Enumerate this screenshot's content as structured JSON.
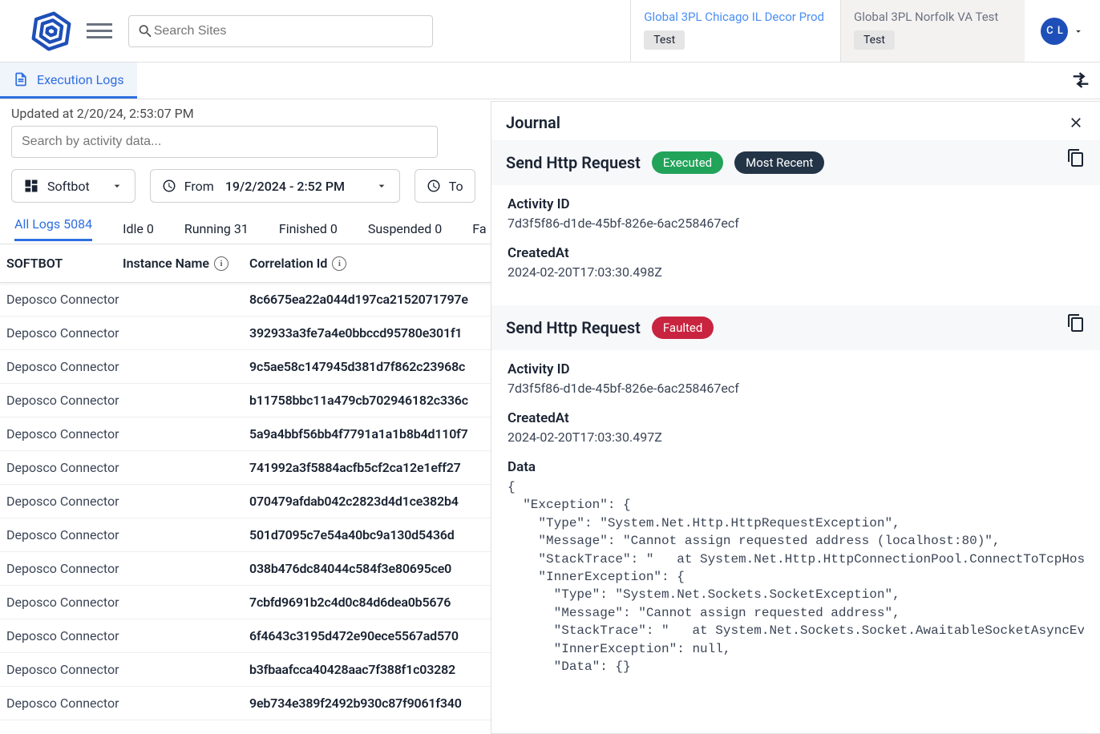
{
  "header": {
    "search_placeholder": "Search Sites",
    "tabs": [
      {
        "title": "Global 3PL Chicago IL Decor Prod",
        "chip": "Test",
        "active": true
      },
      {
        "title": "Global 3PL Norfolk VA Test",
        "chip": "Test",
        "active": false
      }
    ],
    "user_initials": "C L"
  },
  "module_tab": "Execution Logs",
  "updated_at": "Updated at 2/20/24, 2:53:07 PM",
  "activity_search_placeholder": "Search by activity data...",
  "filters": {
    "softbot_label": "Softbot",
    "from_label": "From",
    "from_value": "19/2/2024 - 2:52 PM",
    "to_label": "To"
  },
  "status_tabs": [
    {
      "label": "All Logs",
      "count": "5084",
      "active": true
    },
    {
      "label": "Idle",
      "count": "0"
    },
    {
      "label": "Running",
      "count": "31"
    },
    {
      "label": "Finished",
      "count": "0"
    },
    {
      "label": "Suspended",
      "count": "0"
    },
    {
      "label": "Fa",
      "count": ""
    }
  ],
  "columns": {
    "softbot": "SOFTBOT",
    "instance": "Instance Name",
    "correlation": "Correlation Id"
  },
  "rows": [
    {
      "softbot": "Deposco Connector",
      "corr": "8c6675ea22a044d197ca2152071797e"
    },
    {
      "softbot": "Deposco Connector",
      "corr": "392933a3fe7a4e0bbccd95780e301f1"
    },
    {
      "softbot": "Deposco Connector",
      "corr": "9c5ae58c147945d381d7f862c23968c"
    },
    {
      "softbot": "Deposco Connector",
      "corr": "b11758bbc11a479cb702946182c336c"
    },
    {
      "softbot": "Deposco Connector",
      "corr": "5a9a4bbf56bb4f7791a1a1b8b4d110f7"
    },
    {
      "softbot": "Deposco Connector",
      "corr": "741992a3f5884acfb5cf2ca12e1eff27"
    },
    {
      "softbot": "Deposco Connector",
      "corr": "070479afdab042c2823d4d1ce382b4"
    },
    {
      "softbot": "Deposco Connector",
      "corr": "501d7095c7e54a40bc9a130d5436d"
    },
    {
      "softbot": "Deposco Connector",
      "corr": "038b476dc84044c584f3e80695ce0"
    },
    {
      "softbot": "Deposco Connector",
      "corr": "7cbfd9691b2c4d0c84d6dea0b5676"
    },
    {
      "softbot": "Deposco Connector",
      "corr": "6f4643c3195d472e90ece5567ad570"
    },
    {
      "softbot": "Deposco Connector",
      "corr": "b3fbaafcca40428aac7f388f1c03282"
    },
    {
      "softbot": "Deposco Connector",
      "corr": "9eb734e389f2492b930c87f9061f340"
    }
  ],
  "journal": {
    "title": "Journal",
    "entries": [
      {
        "title": "Send Http Request",
        "badges": [
          {
            "text": "Executed",
            "cls": "green"
          },
          {
            "text": "Most Recent",
            "cls": "dark"
          }
        ],
        "fields": {
          "activity_id_label": "Activity ID",
          "activity_id": "7d3f5f86-d1de-45bf-826e-6ac258467ecf",
          "created_label": "CreatedAt",
          "created": "2024-02-20T17:03:30.498Z"
        }
      },
      {
        "title": "Send Http Request",
        "badges": [
          {
            "text": "Faulted",
            "cls": "red"
          }
        ],
        "fields": {
          "activity_id_label": "Activity ID",
          "activity_id": "7d3f5f86-d1de-45bf-826e-6ac258467ecf",
          "created_label": "CreatedAt",
          "created": "2024-02-20T17:03:30.497Z",
          "data_label": "Data",
          "data_body": "{\n  \"Exception\": {\n    \"Type\": \"System.Net.Http.HttpRequestException\",\n    \"Message\": \"Cannot assign requested address (localhost:80)\",\n    \"StackTrace\": \"   at System.Net.Http.HttpConnectionPool.ConnectToTcpHostA\n    \"InnerException\": {\n      \"Type\": \"System.Net.Sockets.SocketException\",\n      \"Message\": \"Cannot assign requested address\",\n      \"StackTrace\": \"   at System.Net.Sockets.Socket.AwaitableSocketAsyncEver\n      \"InnerException\": null,\n      \"Data\": {}"
        }
      }
    ]
  }
}
